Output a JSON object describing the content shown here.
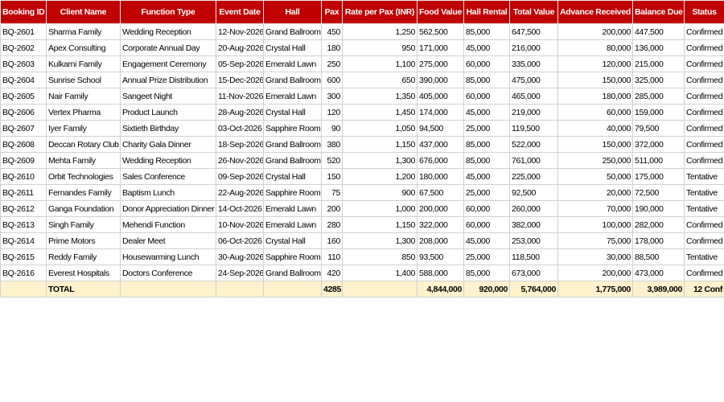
{
  "columns": [
    "Booking ID",
    "Client Name",
    "Function Type",
    "Event Date",
    "Hall",
    "Pax",
    "Rate per Pax (INR)",
    "Food Value",
    "Hall Rental",
    "Total Value",
    "Advance Received",
    "Balance Due",
    "Status"
  ],
  "rows": [
    [
      "BQ-2601",
      "Sharma Family",
      "Wedding Reception",
      "12-Nov-2026",
      "Grand Ballroom",
      "450",
      "1,250",
      "562,500",
      "85,000",
      "647,500",
      "200,000",
      "447,500",
      "Confirmed"
    ],
    [
      "BQ-2602",
      "Apex Consulting",
      "Corporate Annual Day",
      "20-Aug-2026",
      "Crystal Hall",
      "180",
      "950",
      "171,000",
      "45,000",
      "216,000",
      "80,000",
      "136,000",
      "Confirmed"
    ],
    [
      "BQ-2603",
      "Kulkarni Family",
      "Engagement Ceremony",
      "05-Sep-2026",
      "Emerald Lawn",
      "250",
      "1,100",
      "275,000",
      "60,000",
      "335,000",
      "120,000",
      "215,000",
      "Confirmed"
    ],
    [
      "BQ-2604",
      "Sunrise School",
      "Annual Prize Distribution",
      "15-Dec-2026",
      "Grand Ballroom",
      "600",
      "650",
      "390,000",
      "85,000",
      "475,000",
      "150,000",
      "325,000",
      "Confirmed"
    ],
    [
      "BQ-2605",
      "Nair Family",
      "Sangeet Night",
      "11-Nov-2026",
      "Emerald Lawn",
      "300",
      "1,350",
      "405,000",
      "60,000",
      "465,000",
      "180,000",
      "285,000",
      "Confirmed"
    ],
    [
      "BQ-2606",
      "Vertex Pharma",
      "Product Launch",
      "28-Aug-2026",
      "Crystal Hall",
      "120",
      "1,450",
      "174,000",
      "45,000",
      "219,000",
      "60,000",
      "159,000",
      "Confirmed"
    ],
    [
      "BQ-2607",
      "Iyer Family",
      "Sixtieth Birthday",
      "03-Oct-2026",
      "Sapphire Room",
      "90",
      "1,050",
      "94,500",
      "25,000",
      "119,500",
      "40,000",
      "79,500",
      "Confirmed"
    ],
    [
      "BQ-2608",
      "Deccan Rotary Club",
      "Charity Gala Dinner",
      "18-Sep-2026",
      "Grand Ballroom",
      "380",
      "1,150",
      "437,000",
      "85,000",
      "522,000",
      "150,000",
      "372,000",
      "Confirmed"
    ],
    [
      "BQ-2609",
      "Mehta Family",
      "Wedding Reception",
      "26-Nov-2026",
      "Grand Ballroom",
      "520",
      "1,300",
      "676,000",
      "85,000",
      "761,000",
      "250,000",
      "511,000",
      "Confirmed"
    ],
    [
      "BQ-2610",
      "Orbit Technologies",
      "Sales Conference",
      "09-Sep-2026",
      "Crystal Hall",
      "150",
      "1,200",
      "180,000",
      "45,000",
      "225,000",
      "50,000",
      "175,000",
      "Tentative"
    ],
    [
      "BQ-2611",
      "Fernandes Family",
      "Baptism Lunch",
      "22-Aug-2026",
      "Sapphire Room",
      "75",
      "900",
      "67,500",
      "25,000",
      "92,500",
      "20,000",
      "72,500",
      "Tentative"
    ],
    [
      "BQ-2612",
      "Ganga Foundation",
      "Donor Appreciation Dinner",
      "14-Oct-2026",
      "Emerald Lawn",
      "200",
      "1,000",
      "200,000",
      "60,000",
      "260,000",
      "70,000",
      "190,000",
      "Tentative"
    ],
    [
      "BQ-2613",
      "Singh Family",
      "Mehendi Function",
      "10-Nov-2026",
      "Emerald Lawn",
      "280",
      "1,150",
      "322,000",
      "60,000",
      "382,000",
      "100,000",
      "282,000",
      "Confirmed"
    ],
    [
      "BQ-2614",
      "Prime Motors",
      "Dealer Meet",
      "06-Oct-2026",
      "Crystal Hall",
      "160",
      "1,300",
      "208,000",
      "45,000",
      "253,000",
      "75,000",
      "178,000",
      "Confirmed"
    ],
    [
      "BQ-2615",
      "Reddy Family",
      "Housewarming Lunch",
      "30-Aug-2026",
      "Sapphire Room",
      "110",
      "850",
      "93,500",
      "25,000",
      "118,500",
      "30,000",
      "88,500",
      "Tentative"
    ],
    [
      "BQ-2616",
      "Everest Hospitals",
      "Doctors Conference",
      "24-Sep-2026",
      "Grand Ballroom",
      "420",
      "1,400",
      "588,000",
      "85,000",
      "673,000",
      "200,000",
      "473,000",
      "Confirmed"
    ]
  ],
  "total": {
    "label": "TOTAL",
    "pax": "4285",
    "food_value": "4,844,000",
    "hall_rental": "920,000",
    "total_value": "5,764,000",
    "advance_received": "1,775,000",
    "balance_due": "3,989,000",
    "status": "12 Conf"
  }
}
